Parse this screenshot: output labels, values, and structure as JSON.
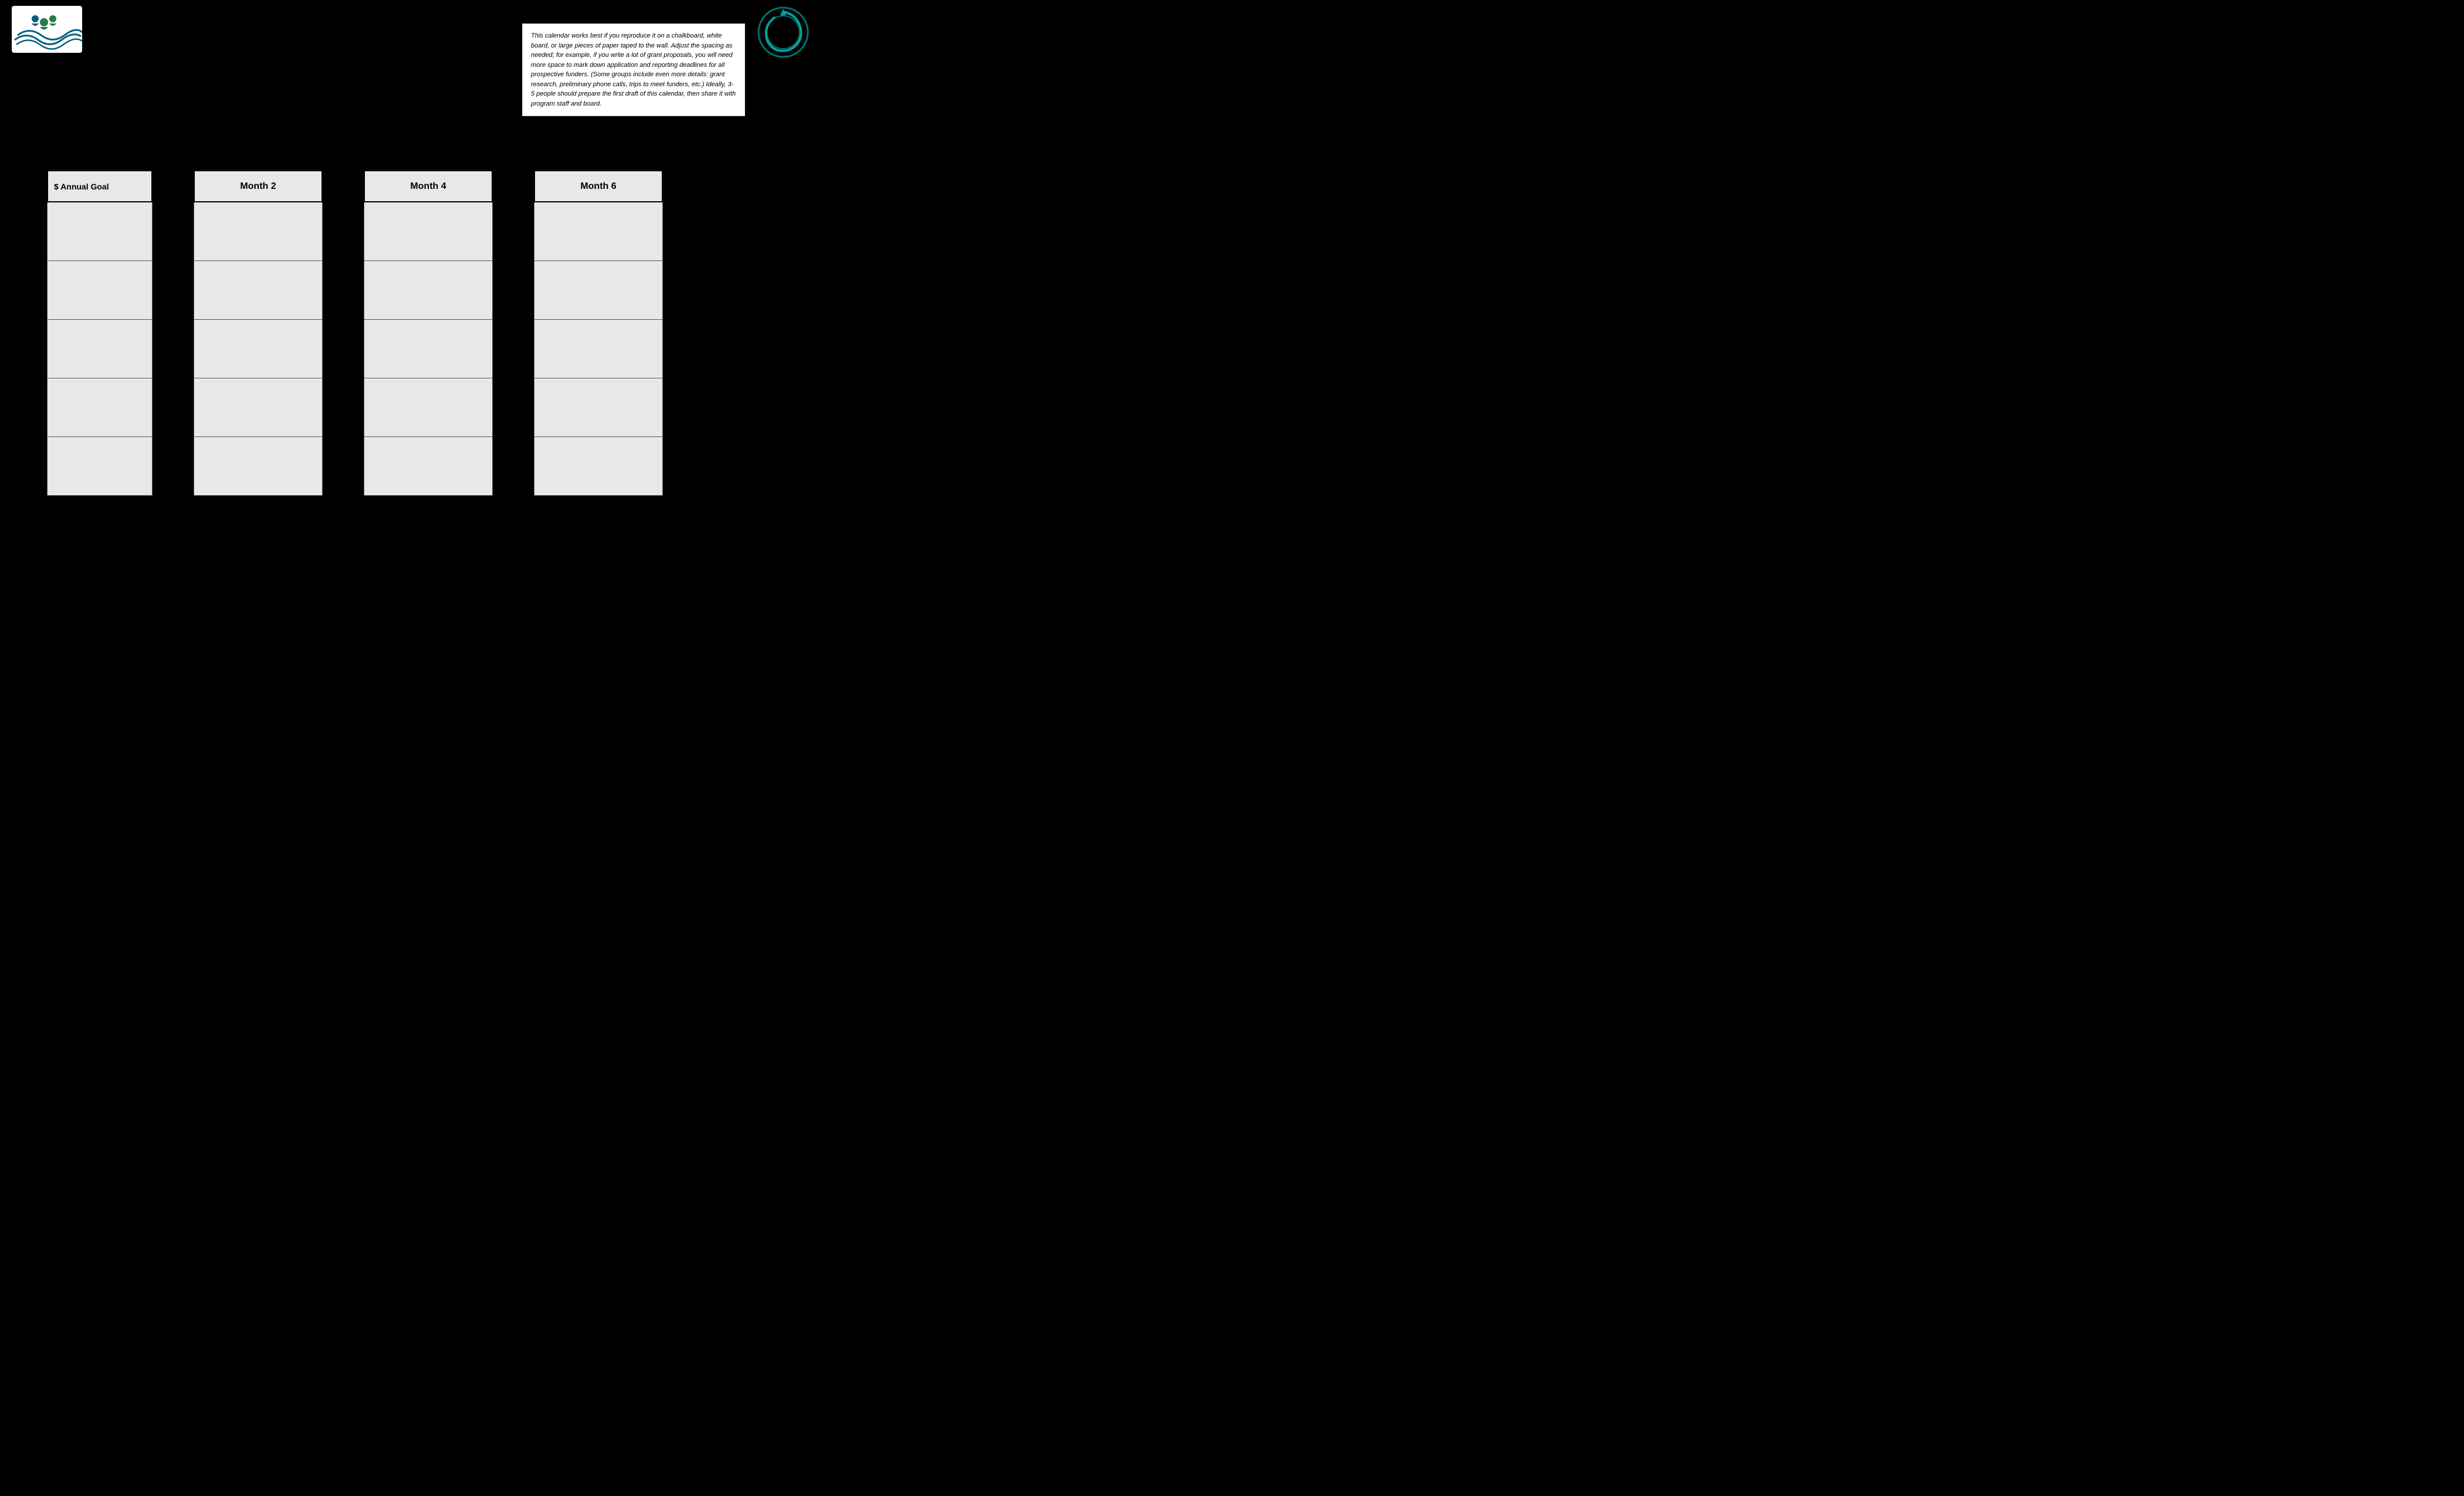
{
  "header": {
    "logo_left_alt": "Left organization logo",
    "logo_right_alt": "Right organization logo"
  },
  "info_box": {
    "text": "This calendar works best if you reproduce it on a chalkboard, white board, or large pieces of paper taped to the wall.   Adjust the spacing as needed; for example, if you write a lot of grant proposals, you will need more space to mark down application and reporting deadlines for all prospective funders. (Some groups include even more details: grant research, preliminary phone calls, trips to meet funders, etc.)  Ideally, 3-5 people should prepare the first draft of this calendar, then share it with program staff and board."
  },
  "columns": [
    {
      "id": "annual",
      "header": "$ Annual Goal",
      "cells": 5
    },
    {
      "id": "month2",
      "header": "Month 2",
      "cells": 5
    },
    {
      "id": "month4",
      "header": "Month 4",
      "cells": 5
    },
    {
      "id": "month6",
      "header": "Month 6",
      "cells": 5
    }
  ]
}
